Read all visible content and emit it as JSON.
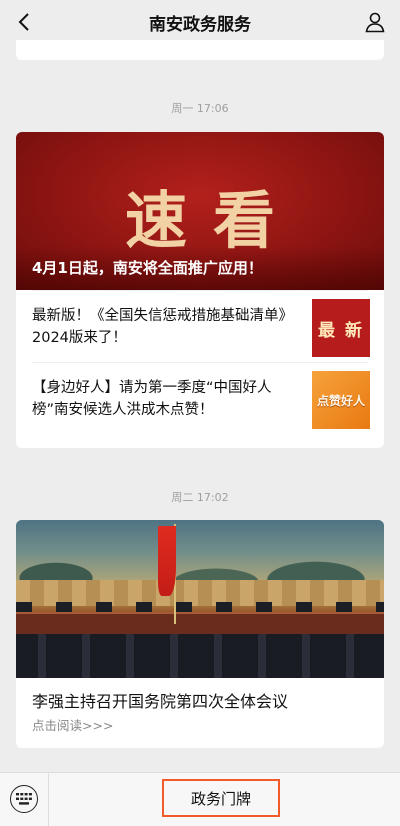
{
  "header": {
    "title": "南安政务服务",
    "back_icon": "chevron-left-icon",
    "profile_icon": "person-icon"
  },
  "feed": [
    {
      "time": "周一 17:06",
      "main": {
        "banner_text": "速看",
        "caption": "4月1日起，南安将全面推广应用！"
      },
      "items": [
        {
          "title": "最新版！《全国失信惩戒措施基础清单》2024版来了！",
          "thumb_text": "最 新"
        },
        {
          "title": "【身边好人】请为第一季度“中国好人榜”南安候选人洪成木点赞！",
          "thumb_text": "点赞好人"
        }
      ]
    },
    {
      "time": "周二 17:02",
      "main": {
        "title": "李强主持召开国务院第四次全体会议",
        "read_more": "点击阅读>>>"
      }
    }
  ],
  "bottom_bar": {
    "keyboard_icon": "keyboard-icon",
    "menu_label": "政务门牌",
    "accent_color": "#f15a2b"
  }
}
